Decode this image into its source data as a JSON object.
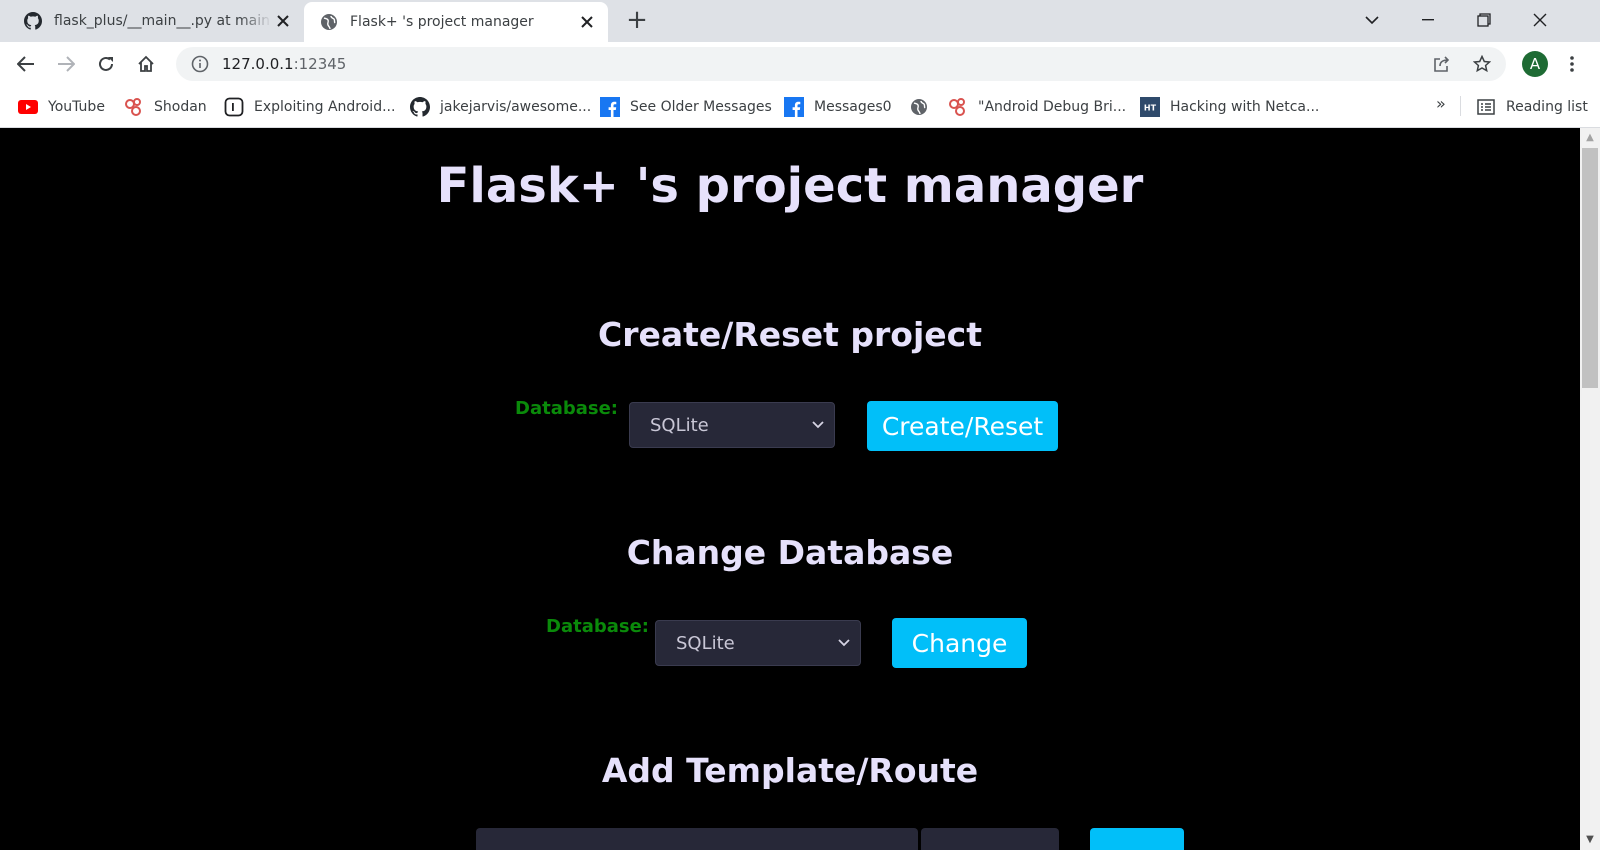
{
  "browser": {
    "tabs": [
      {
        "title": "flask_plus/__main__.py at main · A",
        "icon": "github-icon",
        "active": false
      },
      {
        "title": "Flask+ 's project manager",
        "icon": "globe-icon",
        "active": true
      }
    ],
    "new_tab": "+",
    "url_host": "127.0.0.1",
    "url_port": ":12345",
    "profile_initial": "A",
    "bookmarks": [
      {
        "label": "YouTube",
        "icon": "youtube-icon"
      },
      {
        "label": "Shodan",
        "icon": "shodan-icon"
      },
      {
        "label": "Exploiting Android...",
        "icon": "square-outline-icon"
      },
      {
        "label": "jakejarvis/awesome...",
        "icon": "github-icon"
      },
      {
        "label": "See Older Messages",
        "icon": "facebook-icon"
      },
      {
        "label": "Messages0",
        "icon": "facebook-icon"
      },
      {
        "label": "",
        "icon": "globe-icon"
      },
      {
        "label": "\"Android Debug Bri...",
        "icon": "shodan-icon"
      },
      {
        "label": "Hacking with Netca...",
        "icon": "ht-icon"
      }
    ],
    "bookmarks_overflow": "»",
    "reading_list": "Reading list"
  },
  "page": {
    "title": "Flask+ 's project manager",
    "sections": [
      {
        "heading": "Create/Reset project",
        "label": "Database:",
        "selected": "SQLite",
        "button": "Create/Reset"
      },
      {
        "heading": "Change Database",
        "label": "Database:",
        "selected": "SQLite",
        "button": "Change"
      },
      {
        "heading": "Add Template/Route"
      }
    ]
  },
  "colors": {
    "page_bg": "#000000",
    "heading": "#e6e1fb",
    "label_green": "#0a8a0a",
    "button_accent": "#01bff9",
    "select_bg": "#272838"
  }
}
